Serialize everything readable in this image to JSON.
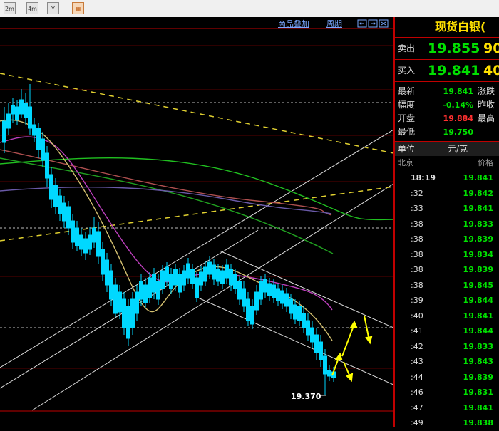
{
  "toolbar": {
    "buttons": [
      {
        "name": "period-2m-button",
        "label": "2m"
      },
      {
        "name": "period-4m-button",
        "label": "4m"
      },
      {
        "name": "filter-button",
        "label": "Y"
      }
    ]
  },
  "chart_header": {
    "overlay_link": "商品叠加",
    "period_link": "周期"
  },
  "chart_data": {
    "type": "candlestick",
    "low_marker": "19.370"
  },
  "quote": {
    "title": "现货白银(",
    "sell": {
      "label": "卖出",
      "price": "19.855",
      "volume": "90"
    },
    "buy": {
      "label": "买入",
      "price": "19.841",
      "volume": "40"
    },
    "stats": [
      {
        "label": "最新",
        "value": "19.841",
        "color": "#00e000",
        "label2": "涨跌"
      },
      {
        "label": "幅度",
        "value": "-0.14%",
        "color": "#00e000",
        "label2": "昨收"
      },
      {
        "label": "开盘",
        "value": "19.884",
        "color": "#ff3030",
        "label2": "最高"
      },
      {
        "label": "最低",
        "value": "19.750",
        "color": "#00e000",
        "label2": ""
      }
    ],
    "unit_label": "单位",
    "unit_value": "元/克",
    "col_time": "北京",
    "col_price": "价格",
    "ticks": [
      {
        "t": "18:19",
        "p": "19.841"
      },
      {
        "t": ":32",
        "p": "19.842"
      },
      {
        "t": ":33",
        "p": "19.841"
      },
      {
        "t": ":38",
        "p": "19.833"
      },
      {
        "t": ":38",
        "p": "19.839"
      },
      {
        "t": ":38",
        "p": "19.834"
      },
      {
        "t": ":38",
        "p": "19.839"
      },
      {
        "t": ":38",
        "p": "19.845"
      },
      {
        "t": ":39",
        "p": "19.844"
      },
      {
        "t": ":40",
        "p": "19.841"
      },
      {
        "t": ":41",
        "p": "19.844"
      },
      {
        "t": ":42",
        "p": "19.833"
      },
      {
        "t": ":43",
        "p": "19.843"
      },
      {
        "t": ":44",
        "p": "19.839"
      },
      {
        "t": ":46",
        "p": "19.831"
      },
      {
        "t": ":47",
        "p": "19.841"
      },
      {
        "t": ":49",
        "p": "19.838"
      }
    ]
  }
}
